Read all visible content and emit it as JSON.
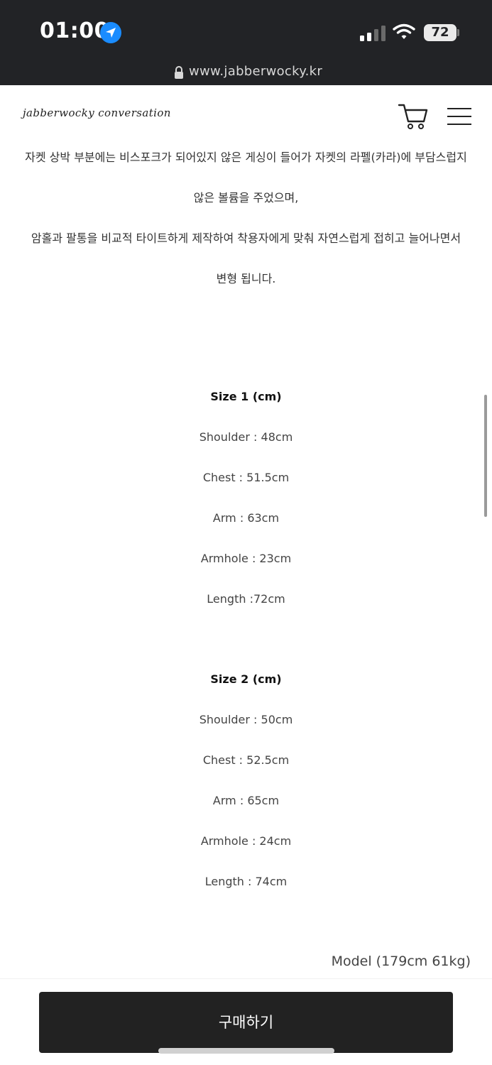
{
  "status_bar": {
    "time": "01:00",
    "battery": "72",
    "icons": [
      "location-arrow-icon",
      "signal-icon",
      "wifi-icon",
      "battery-icon"
    ]
  },
  "browser": {
    "url": "www.jabberwocky.kr",
    "icons": [
      "lock-icon"
    ]
  },
  "header": {
    "logo": "jabberwocky conversation",
    "icons": [
      "cart-icon",
      "hamburger-menu-icon"
    ]
  },
  "description": [
    "자켓 상박 부분에는 비스포크가 되어있지 않은 게싱이 들어가 자켓의 라펠(카라)에 부담스럽지",
    "않은 볼륨을 주었으며,",
    "암홀과 팔통을 비교적 타이트하게 제작하여  착용자에게 맞춰 자연스럽게 접히고 늘어나면서",
    "변형 됩니다."
  ],
  "sizes": [
    {
      "title": "Size 1 (cm)",
      "lines": [
        "Shoulder : 48cm",
        "Chest : 51.5cm",
        "Arm : 63cm",
        "Armhole : 23cm",
        "Length :72cm"
      ]
    },
    {
      "title": "Size 2 (cm)",
      "lines": [
        "Shoulder : 50cm",
        "Chest : 52.5cm",
        "Arm : 65cm",
        "Armhole : 24cm",
        "Length : 74cm"
      ]
    }
  ],
  "model": "Model (179cm 61kg)",
  "buy_button": "구매하기",
  "colors": {
    "status_bar_bg": "#222326",
    "buy_button_bg": "#222222",
    "location_blue": "#1a8cff"
  }
}
